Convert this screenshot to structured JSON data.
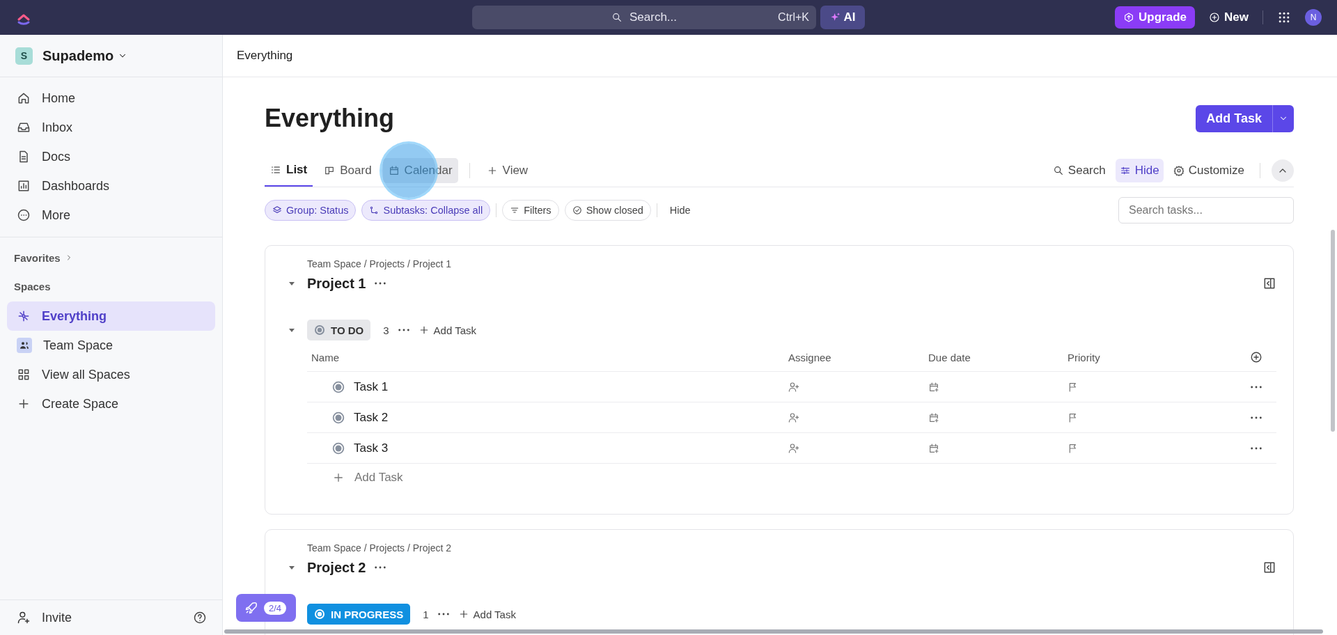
{
  "app_bar": {
    "search": {
      "placeholder": "Search...",
      "shortcut": "Ctrl+K"
    },
    "ai_label": "AI",
    "upgrade": "Upgrade",
    "new_label": "New",
    "avatar": "N"
  },
  "sidebar": {
    "workspace": {
      "initial": "S",
      "name": "Supademo"
    },
    "nav": [
      {
        "label": "Home"
      },
      {
        "label": "Inbox"
      },
      {
        "label": "Docs"
      },
      {
        "label": "Dashboards"
      },
      {
        "label": "More"
      }
    ],
    "favorites": "Favorites",
    "spaces_heading": "Spaces",
    "spaces": [
      {
        "label": "Everything",
        "selected": true
      },
      {
        "label": "Team Space",
        "selected": false
      },
      {
        "label": "View all Spaces",
        "selected": false
      },
      {
        "label": "Create Space",
        "selected": false
      }
    ],
    "invite": "Invite"
  },
  "breadcrumb": "Everything",
  "page_title": "Everything",
  "add_task": "Add Task",
  "views": [
    {
      "label": "List",
      "selected": true,
      "hovered": false
    },
    {
      "label": "Board",
      "selected": false,
      "hovered": false
    },
    {
      "label": "Calendar",
      "selected": false,
      "hovered": true
    }
  ],
  "add_view": "View",
  "view_actions": [
    {
      "label": "Search",
      "active": false
    },
    {
      "label": "Hide",
      "active": true
    },
    {
      "label": "Customize",
      "active": false
    }
  ],
  "filters": [
    {
      "kind": "chip",
      "label": "Group: Status"
    },
    {
      "kind": "chip",
      "label": "Subtasks: Collapse all"
    },
    {
      "kind": "pill",
      "label": "Filters"
    },
    {
      "kind": "pill",
      "label": "Show closed"
    },
    {
      "kind": "plain",
      "label": "Hide"
    }
  ],
  "task_search": {
    "placeholder": "Search tasks..."
  },
  "lists": [
    {
      "path": "Team Space / Projects / Project 1",
      "name": "Project 1",
      "groups": [
        {
          "status": "TO DO",
          "kind": "soft",
          "color": "#87909e",
          "count": "3",
          "add_label": "Add Task",
          "columns": [
            "Name",
            "Assignee",
            "Due date",
            "Priority"
          ],
          "tasks": [
            {
              "name": "Task 1"
            },
            {
              "name": "Task 2"
            },
            {
              "name": "Task 3"
            }
          ],
          "add_row": "Add Task"
        }
      ]
    },
    {
      "path": "Team Space / Projects / Project 2",
      "name": "Project 2",
      "groups": [
        {
          "status": "IN PROGRESS",
          "kind": "solid",
          "color": "#1090e0",
          "count": "1",
          "add_label": "Add Task"
        }
      ]
    }
  ],
  "tour_badge": {
    "progress": "2/4"
  }
}
